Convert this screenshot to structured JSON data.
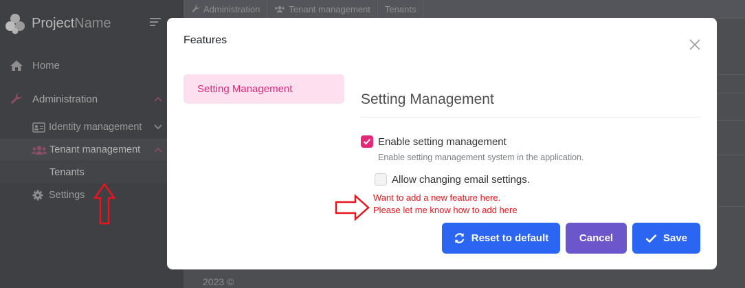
{
  "brand": {
    "name_primary": "Project",
    "name_secondary": "Name"
  },
  "sidebar": {
    "home": "Home",
    "administration": "Administration",
    "identity_management": "Identity management",
    "tenant_management": "Tenant management",
    "tenants": "Tenants",
    "settings": "Settings"
  },
  "breadcrumbs": [
    "Administration",
    "Tenant management",
    "Tenants"
  ],
  "footer": {
    "copyright": "2023 ©"
  },
  "modal": {
    "title": "Features",
    "tabs": [
      {
        "label": "Setting Management",
        "active": true
      }
    ],
    "section_title": "Setting Management",
    "features": [
      {
        "label": "Enable setting management",
        "description": "Enable setting management system in the application.",
        "checked": true
      },
      {
        "label": "Allow changing email settings.",
        "checked": false
      }
    ],
    "annotation": "Want to add a new feature here. Please let me know how to add here",
    "buttons": {
      "reset": "Reset to default",
      "cancel": "Cancel",
      "save": "Save"
    }
  },
  "colors": {
    "accent_pink": "#e6287b",
    "primary_blue": "#2b66f3",
    "cancel_purple": "#6b56cc",
    "annotation_red": "#e8141b"
  }
}
